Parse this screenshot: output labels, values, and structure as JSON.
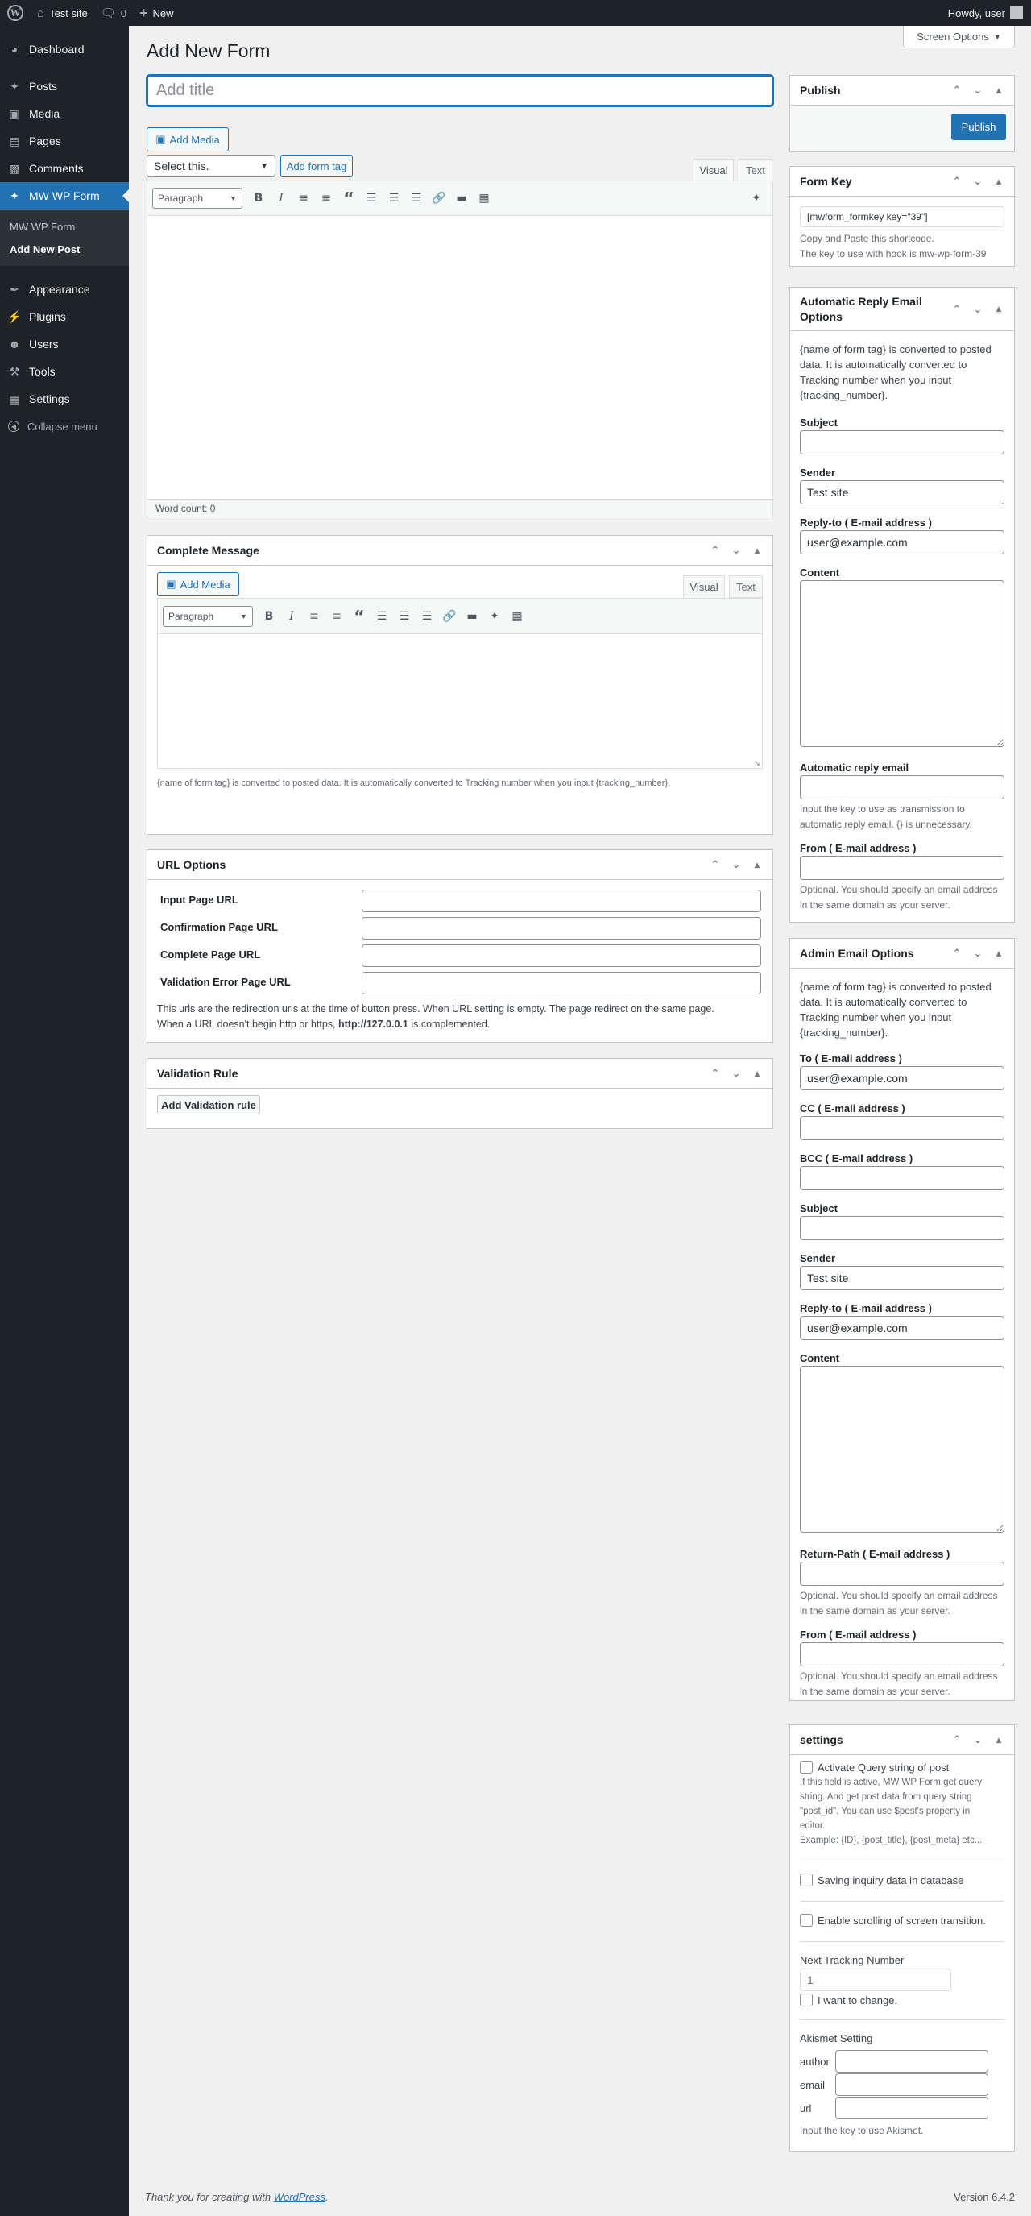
{
  "adminbar": {
    "site_name": "Test site",
    "comments_count": "0",
    "new_label": "New",
    "howdy": "Howdy, user"
  },
  "sidebar": {
    "items": [
      {
        "label": "Dashboard",
        "icon": "dashboard-icon"
      },
      {
        "label": "Posts",
        "icon": "pin-icon"
      },
      {
        "label": "Media",
        "icon": "media-icon"
      },
      {
        "label": "Pages",
        "icon": "page-icon"
      },
      {
        "label": "Comments",
        "icon": "comment-icon"
      },
      {
        "label": "MW WP Form",
        "icon": "pin-icon"
      },
      {
        "label": "Appearance",
        "icon": "brush-icon"
      },
      {
        "label": "Plugins",
        "icon": "plug-icon"
      },
      {
        "label": "Users",
        "icon": "users-icon"
      },
      {
        "label": "Tools",
        "icon": "wrench-icon"
      },
      {
        "label": "Settings",
        "icon": "settings-icon"
      }
    ],
    "submenu": [
      "MW WP Form",
      "Add New Post"
    ],
    "collapse": "Collapse menu"
  },
  "screen_options": "Screen Options",
  "page_title": "Add New Form",
  "title_placeholder": "Add title",
  "editor": {
    "add_media": "Add Media",
    "select_value": "Select this.",
    "add_form_tag": "Add form tag",
    "tab_visual": "Visual",
    "tab_text": "Text",
    "format": "Paragraph",
    "word_count": "Word count: 0"
  },
  "complete_message": {
    "title": "Complete Message",
    "add_media": "Add Media",
    "tab_visual": "Visual",
    "tab_text": "Text",
    "format": "Paragraph",
    "help": "{name of form tag} is converted to posted data. It is automatically converted to Tracking number when you input {tracking_number}."
  },
  "url_options": {
    "title": "URL Options",
    "labels": [
      "Input Page URL",
      "Confirmation Page URL",
      "Complete Page URL",
      "Validation Error Page URL"
    ],
    "help_1": "This urls are the redirection urls at the time of button press. When URL setting is empty. The page redirect on the same page.",
    "help_2a": "When a URL doesn't begin http or https,",
    "help_2b": "http://127.0.0.1",
    "help_2c": "is complemented."
  },
  "validation_rule": {
    "title": "Validation Rule",
    "button": "Add Validation rule"
  },
  "publish": {
    "title": "Publish",
    "button": "Publish"
  },
  "form_key": {
    "title": "Form Key",
    "value": "[mwform_formkey key=\"39\"]",
    "help_1": "Copy and Paste this shortcode.",
    "help_2": "The key to use with hook is mw-wp-form-39"
  },
  "auto_reply": {
    "title_1": "Automatic Reply Email",
    "title_2": "Options",
    "intro": [
      "{name of form tag} is converted to posted",
      "data. It is automatically converted to",
      "Tracking number when you input",
      "{tracking_number}."
    ],
    "subject_label": "Subject",
    "subject_value": "",
    "sender_label": "Sender",
    "sender_value": "Test site",
    "replyto_label": "Reply-to ( E-mail address )",
    "replyto_value": "user@example.com",
    "content_label": "Content",
    "auto_reply_label": "Automatic reply email",
    "auto_reply_help": [
      "Input the key to use as transmission to",
      "automatic reply email. {} is unnecessary."
    ],
    "from_label": "From ( E-mail address )",
    "from_help": [
      "Optional. You should specify an email address",
      "in the same domain as your server."
    ]
  },
  "admin_email": {
    "title": "Admin Email Options",
    "intro": [
      "{name of form tag} is converted to posted",
      "data. It is automatically converted to",
      "Tracking number when you input",
      "{tracking_number}."
    ],
    "to_label": "To ( E-mail address )",
    "to_value": "user@example.com",
    "cc_label": "CC ( E-mail address )",
    "bcc_label": "BCC ( E-mail address )",
    "subject_label": "Subject",
    "sender_label": "Sender",
    "sender_value": "Test site",
    "replyto_label": "Reply-to ( E-mail address )",
    "replyto_value": "user@example.com",
    "content_label": "Content",
    "return_path_label": "Return-Path ( E-mail address )",
    "return_path_help": [
      "Optional. You should specify an email address",
      "in the same domain as your server."
    ],
    "from_label": "From ( E-mail address )",
    "from_help": [
      "Optional. You should specify an email address",
      "in the same domain as your server."
    ]
  },
  "settings": {
    "title": "settings",
    "query_label": "Activate Query string of post",
    "query_help": [
      "If this field is active, MW WP Form get query",
      "string. And get post data from query string",
      "\"post_id\". You can use $post's property in",
      "editor.",
      "Example: {ID}, {post_title}, {post_meta} etc..."
    ],
    "saving_label": "Saving inquiry data in database",
    "scroll_label": "Enable scrolling of screen transition.",
    "tracking_label": "Next Tracking Number",
    "tracking_placeholder": "1",
    "change_label": "I want to change.",
    "akismet_label": "Akismet Setting",
    "akismet_fields": [
      "author",
      "email",
      "url"
    ],
    "akismet_help": "Input the key to use Akismet."
  },
  "footer": {
    "thanks": "Thank you for creating with",
    "wp_link": "WordPress",
    "dot": ".",
    "version": "Version 6.4.2"
  },
  "colors": {
    "accent": "#2271b1",
    "sidebar_bg": "#1d2327",
    "page_bg": "#f0f0f1"
  }
}
